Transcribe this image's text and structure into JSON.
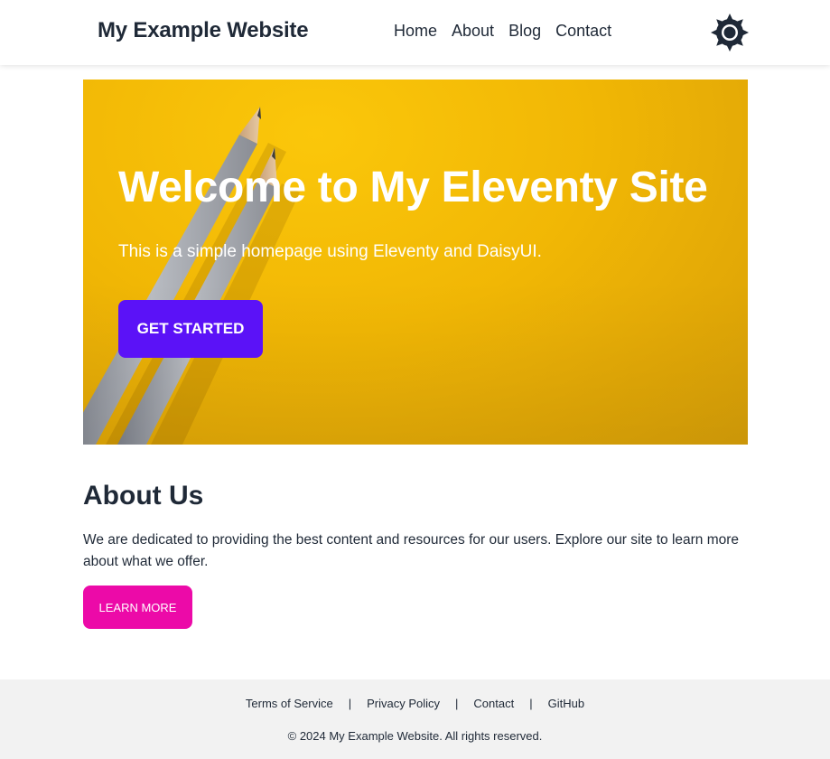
{
  "navbar": {
    "brand": "My Example Website",
    "links": [
      "Home",
      "About",
      "Blog",
      "Contact"
    ],
    "theme_icon": "sun-icon"
  },
  "hero": {
    "title": "Welcome to My Eleventy Site",
    "subtitle": "This is a simple homepage using Eleventy and DaisyUI.",
    "cta_label": "GET STARTED",
    "background_color": "#f1b705",
    "cta_color": "#5b12f7"
  },
  "about": {
    "title": "About Us",
    "text": "We are dedicated to providing the best content and resources for our users. Explore our site to learn more about what we offer.",
    "button_label": "LEARN MORE",
    "button_color": "#ec0aa8"
  },
  "footer": {
    "links": [
      "Terms of Service",
      "Privacy Policy",
      "Contact",
      "GitHub"
    ],
    "separator": "|",
    "copyright": "© 2024 My Example Website. All rights reserved."
  }
}
